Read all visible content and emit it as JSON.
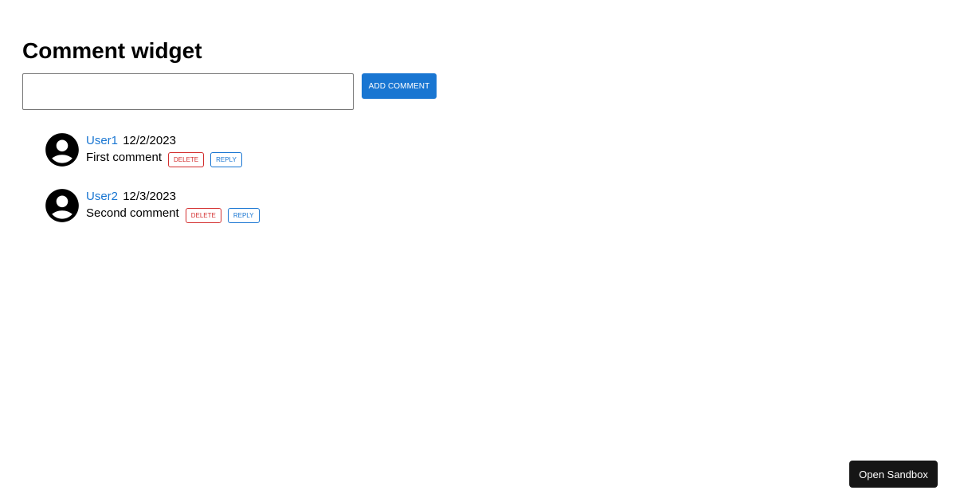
{
  "page": {
    "title": "Comment widget"
  },
  "composer": {
    "input_value": "",
    "add_button_label": "ADD COMMENT"
  },
  "comments": [
    {
      "user": "User1",
      "date": "12/2/2023",
      "text": "First comment",
      "delete_label": "DELETE",
      "reply_label": "REPLY"
    },
    {
      "user": "User2",
      "date": "12/3/2023",
      "text": "Second comment",
      "delete_label": "DELETE",
      "reply_label": "REPLY"
    }
  ],
  "footer": {
    "sandbox_button_label": "Open Sandbox"
  },
  "icons": {
    "avatar": "account-circle-icon"
  },
  "colors": {
    "primary": "#1976d2",
    "danger": "#d32f2f",
    "sandbox_button_bg": "#151515"
  }
}
